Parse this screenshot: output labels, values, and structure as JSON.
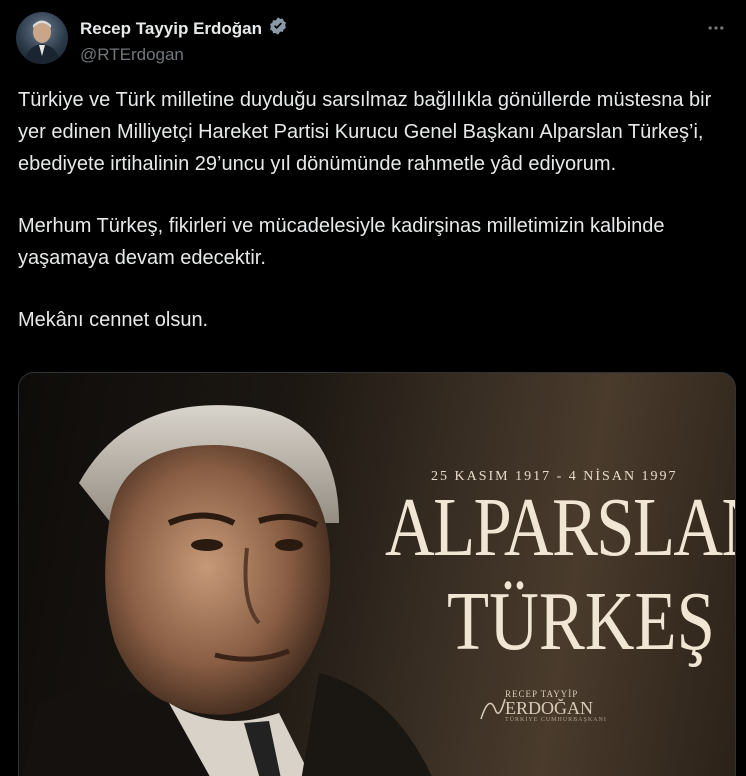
{
  "author": {
    "display_name": "Recep Tayyip Erdoğan",
    "handle": "@RTErdogan",
    "verified_icon": "verified-badge-icon",
    "verified_color": "#8b98a5"
  },
  "tweet": {
    "paragraphs": [
      "Türkiye ve Türk milletine duyduğu sarsılmaz bağlılıkla gönüllerde müstesna bir yer edinen Milliyetçi Hareket Partisi Kurucu Genel Başkanı Alparslan Türkeş’i, ebediyete irtihalinin 29’uncu yıl dönümünde rahmetle yâd ediyorum.",
      "Merhum Türkeş, fikirleri ve mücadelesiyle kadirşinas milletimizin kalbinde yaşamaya devam edecektir.",
      "Mekânı cennet olsun."
    ]
  },
  "media": {
    "dates": "25 KASIM 1917 - 4 NİSAN 1997",
    "first_name": "ALPARSLAN",
    "last_name": "TÜRKEŞ",
    "signature_top": "RECEP TAYYİP",
    "signature_name": "ERDOĞAN",
    "signature_bottom": "TÜRKİYE CUMHURBAŞKANI"
  },
  "more_icon": "more-horizontal-icon"
}
